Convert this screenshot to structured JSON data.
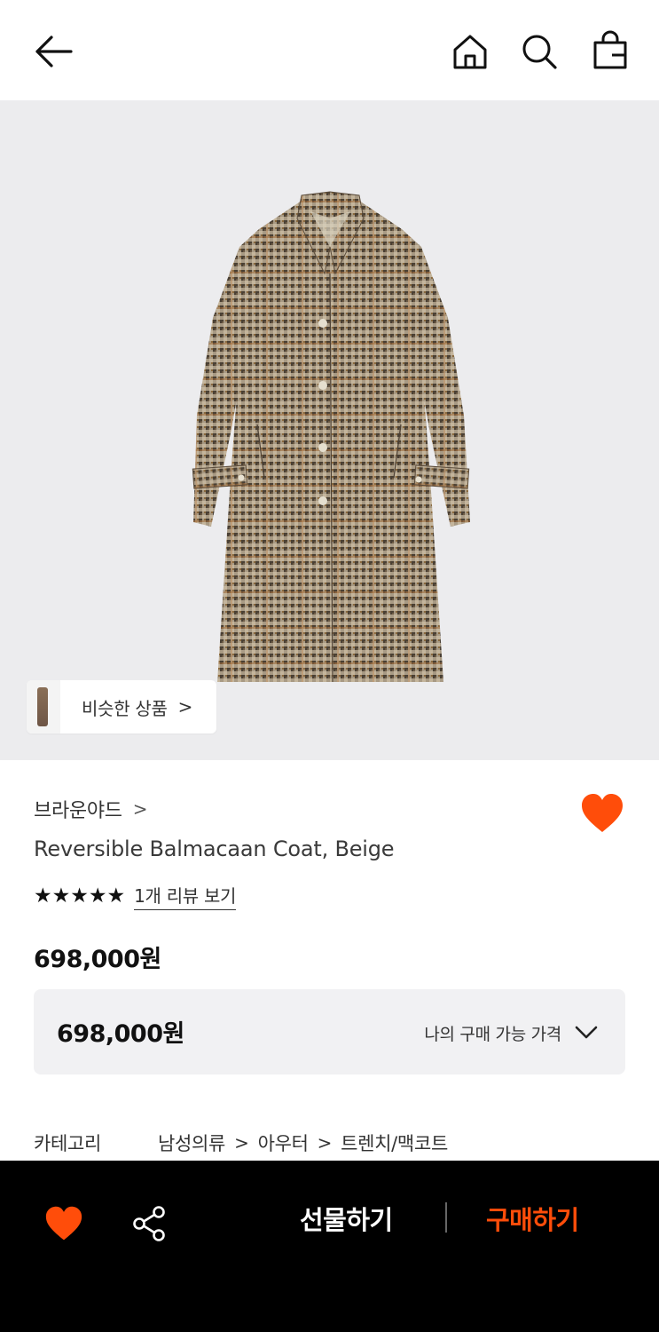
{
  "header": {
    "back_icon": "arrow-left-icon",
    "home_icon": "home-icon",
    "search_icon": "search-icon",
    "bag_icon": "shopping-bag-icon"
  },
  "product_image": {
    "alt": "houndstooth balmacaan coat",
    "similar_label": "비슷한 상품",
    "similar_chevron": ">"
  },
  "product": {
    "brand": "브라운야드",
    "brand_chevron": ">",
    "name": "Reversible Balmacaan Coat, Beige",
    "stars": "★★★★★",
    "rating": 5,
    "review_link": "1개 리뷰 보기",
    "price": "698,000원",
    "liked": true
  },
  "price_box": {
    "price": "698,000원",
    "label": "나의 구매 가능 가격"
  },
  "category": {
    "label": "카테고리",
    "path": [
      "남성의류",
      "아우터",
      "트렌치/맥코트"
    ],
    "separator": ">"
  },
  "bottom_bar": {
    "gift_label": "선물하기",
    "buy_label": "구매하기"
  },
  "colors": {
    "accent": "#ff4d0a",
    "bottom_bar_bg": "#000000",
    "hero_bg": "#ececee",
    "price_box_bg": "#f1f1f3"
  }
}
